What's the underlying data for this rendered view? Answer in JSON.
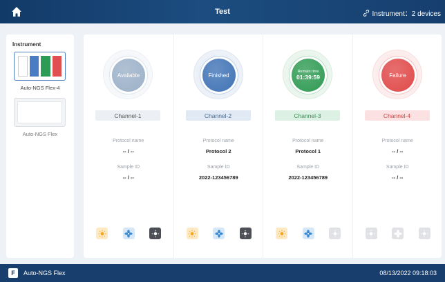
{
  "header": {
    "title": "Test",
    "instrument_info": "Instrument：2 devices"
  },
  "sidebar": {
    "title": "Instrument",
    "devices": [
      {
        "name": "Auto-NGS Flex-4",
        "selected": true
      },
      {
        "name": "Auto-NGS Flex",
        "selected": false
      }
    ],
    "flex4_bar_colors": [
      "#ffffff",
      "#4a7cc4",
      "#2d9a55",
      "#e05050"
    ]
  },
  "labels": {
    "protocol": "Protocol name",
    "sample": "Sample ID"
  },
  "channels": [
    {
      "status": "Available",
      "name": "Channel-1",
      "protocol": "-- / --",
      "sample": "-- / --",
      "color": "#9bb0c8",
      "label_bg": "#eceff3",
      "label_color": "#555"
    },
    {
      "status": "Finished",
      "name": "Channel-2",
      "protocol": "Protocol 2",
      "sample": "2022-123456789",
      "color": "#3f72b5",
      "label_bg": "#e1e9f4",
      "label_color": "#4a6a90"
    },
    {
      "status_top": "Remain time",
      "status": "01:39:59",
      "name": "Channel-3",
      "protocol": "Protocol 1",
      "sample": "2022-123456789",
      "color": "#2e9a52",
      "label_bg": "#dcf1e3",
      "label_color": "#3c8a58"
    },
    {
      "status": "Failure",
      "name": "Channel-4",
      "protocol": "-- / --",
      "sample": "-- / --",
      "color": "#e04848",
      "label_bg": "#fbe1e1",
      "label_color": "#c44"
    }
  ],
  "footer": {
    "app_letter": "F",
    "app_name": "Auto-NGS Flex",
    "datetime": "08/13/2022 09:18:03"
  }
}
